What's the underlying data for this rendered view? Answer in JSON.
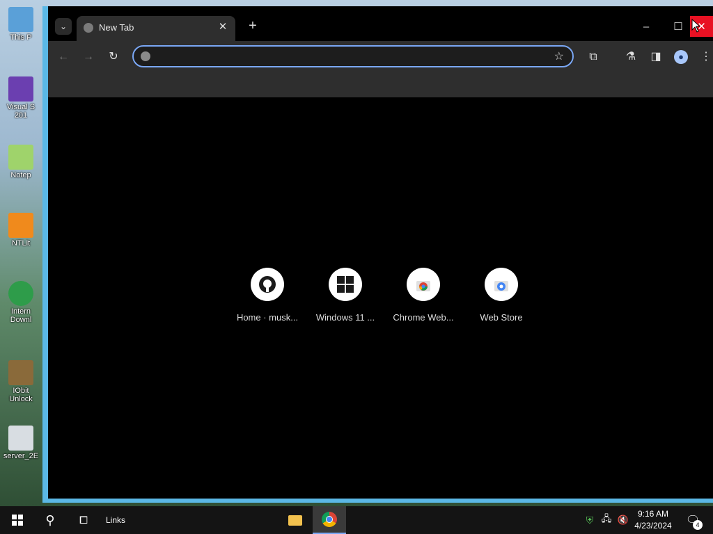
{
  "desktop": {
    "icons": [
      {
        "label": "This P"
      },
      {
        "label": "Visual S 201"
      },
      {
        "label": "Notep"
      },
      {
        "label": "NTLit"
      },
      {
        "label": "Intern Downl"
      },
      {
        "label": "IObit Unlock"
      },
      {
        "label": "server_2E"
      }
    ]
  },
  "browser": {
    "tab": {
      "title": "New Tab",
      "close": "✕"
    },
    "new_tab": "+",
    "window": {
      "minimize": "–",
      "maximize": "☐",
      "close": "✕"
    },
    "omnibox": {
      "value": "",
      "placeholder": ""
    },
    "shortcuts": [
      {
        "label": "Home · musk..."
      },
      {
        "label": "Windows 11 ..."
      },
      {
        "label": "Chrome Web..."
      },
      {
        "label": "Web Store"
      }
    ]
  },
  "taskbar": {
    "links_label": "Links",
    "clock_time": "9:16 AM",
    "clock_date": "4/23/2024",
    "notification_count": "4"
  },
  "colors": {
    "accent": "#7aa7f5",
    "window_border": "#5bb8e6",
    "close_red": "#e81123"
  }
}
